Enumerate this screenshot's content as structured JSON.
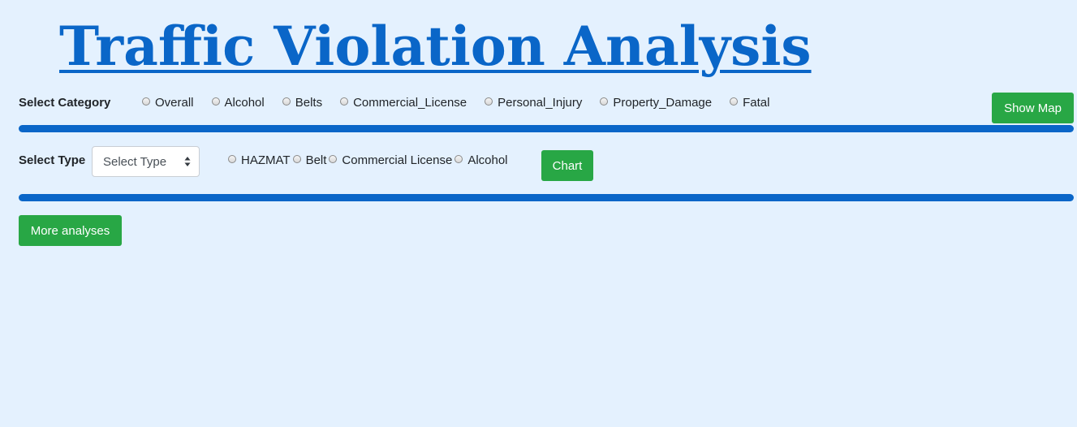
{
  "page": {
    "title": "Traffic Violation Analysis"
  },
  "category": {
    "label": "Select Category",
    "options": [
      "Overall",
      "Alcohol",
      "Belts",
      "Commercial_License",
      "Personal_Injury",
      "Property_Damage",
      "Fatal"
    ],
    "show_map_label": "Show Map"
  },
  "type": {
    "label": "Select Type",
    "select_value": "Select Type",
    "options": [
      "HAZMAT",
      "Belt",
      "Commercial License",
      "Alcohol"
    ],
    "chart_label": "Chart"
  },
  "more": {
    "label": "More analyses"
  },
  "colors": {
    "background": "#e4f1fe",
    "title": "#0a66c8",
    "divider": "#0a66c8",
    "button": "#28a745"
  }
}
